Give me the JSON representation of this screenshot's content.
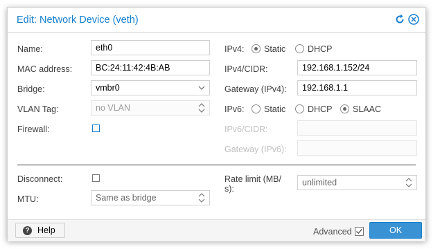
{
  "dialog": {
    "title": "Edit: Network Device (veth)",
    "refresh_icon": "refresh-icon",
    "close_icon": "close-icon"
  },
  "left": {
    "name": {
      "label": "Name:",
      "value": "eth0"
    },
    "mac": {
      "label": "MAC address:",
      "value": "BC:24:11:42:4B:AB"
    },
    "bridge": {
      "label": "Bridge:",
      "value": "vmbr0"
    },
    "vlan": {
      "label": "VLAN Tag:",
      "placeholder": "no VLAN"
    },
    "firewall": {
      "label": "Firewall:",
      "checked": false
    }
  },
  "right": {
    "ipv4": {
      "label": "IPv4:",
      "options": [
        "Static",
        "DHCP"
      ],
      "selected": "Static"
    },
    "ipv4_cidr": {
      "label": "IPv4/CIDR:",
      "value": "192.168.1.152/24"
    },
    "gateway4": {
      "label": "Gateway (IPv4):",
      "value": "192.168.1.1"
    },
    "ipv6": {
      "label": "IPv6:",
      "options": [
        "Static",
        "DHCP",
        "SLAAC"
      ],
      "selected": "SLAAC"
    },
    "ipv6_cidr": {
      "label": "IPv6/CIDR:",
      "value": ""
    },
    "gateway6": {
      "label": "Gateway (IPv6):",
      "value": ""
    }
  },
  "advanced": {
    "disconnect": {
      "label": "Disconnect:",
      "checked": false
    },
    "mtu": {
      "label": "MTU:",
      "placeholder": "Same as bridge"
    },
    "rate_limit": {
      "label_line1": "Rate limit (MB/",
      "label_line2": "s):",
      "placeholder": "unlimited"
    }
  },
  "footer": {
    "help_label": "Help",
    "advanced_label": "Advanced",
    "advanced_checked": true,
    "ok_label": "OK"
  },
  "colors": {
    "accent": "#157fcc",
    "ok_button": "#3892d4"
  }
}
